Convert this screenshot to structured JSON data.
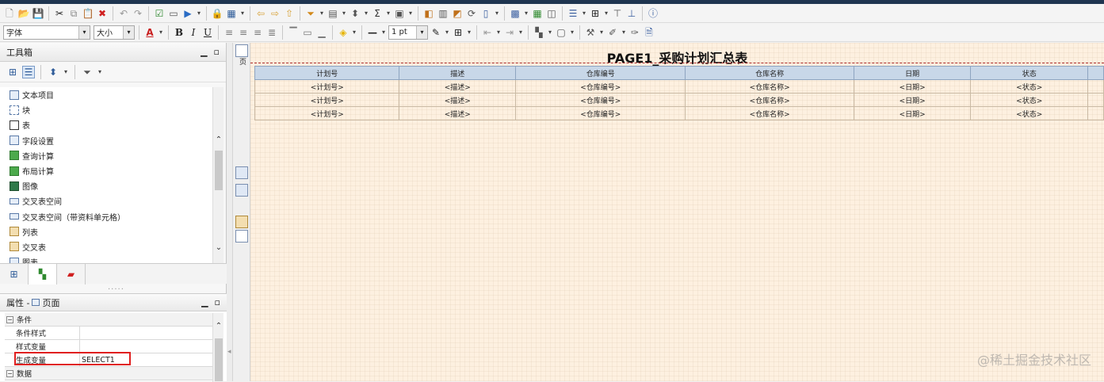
{
  "toolbar2": {
    "font_value": "字体",
    "size_value": "大小",
    "line_width": "1 pt"
  },
  "toolbox": {
    "title": "工具箱",
    "items": [
      {
        "label": "文本项目"
      },
      {
        "label": "块"
      },
      {
        "label": "表"
      },
      {
        "label": "字段设置"
      },
      {
        "label": "查询计算"
      },
      {
        "label": "布局计算"
      },
      {
        "label": "图像"
      },
      {
        "label": "交叉表空间"
      },
      {
        "label": "交叉表空间（带资料单元格）"
      },
      {
        "label": "列表"
      },
      {
        "label": "交叉表"
      },
      {
        "label": "图表"
      }
    ]
  },
  "properties": {
    "title_prefix": "属性 -",
    "title_object": "页面",
    "rows": [
      {
        "key": "条件",
        "value": "",
        "group": true
      },
      {
        "key": "条件样式",
        "value": ""
      },
      {
        "key": "样式变量",
        "value": ""
      },
      {
        "key": "生成变量",
        "value": "SELECT1"
      },
      {
        "key": "数据",
        "value": "",
        "group": true
      }
    ]
  },
  "canvas": {
    "page_label": "页",
    "report_title": "PAGE1_采购计划汇总表",
    "columns": [
      "计划号",
      "描述",
      "仓库编号",
      "仓库名称",
      "日期",
      "状态"
    ],
    "rows": [
      [
        "<计划号>",
        "<描述>",
        "<仓库编号>",
        "<仓库名称>",
        "<日期>",
        "<状态>"
      ],
      [
        "<计划号>",
        "<描述>",
        "<仓库编号>",
        "<仓库名称>",
        "<日期>",
        "<状态>"
      ],
      [
        "<计划号>",
        "<描述>",
        "<仓库编号>",
        "<仓库名称>",
        "<日期>",
        "<状态>"
      ]
    ]
  },
  "watermark": "@稀土掘金技术社区",
  "colors": {
    "accent_bar": "#1f3550",
    "canvas_bg": "#fdf0e0",
    "header_bg": "#c8d7e8",
    "highlight": "#e02020"
  }
}
